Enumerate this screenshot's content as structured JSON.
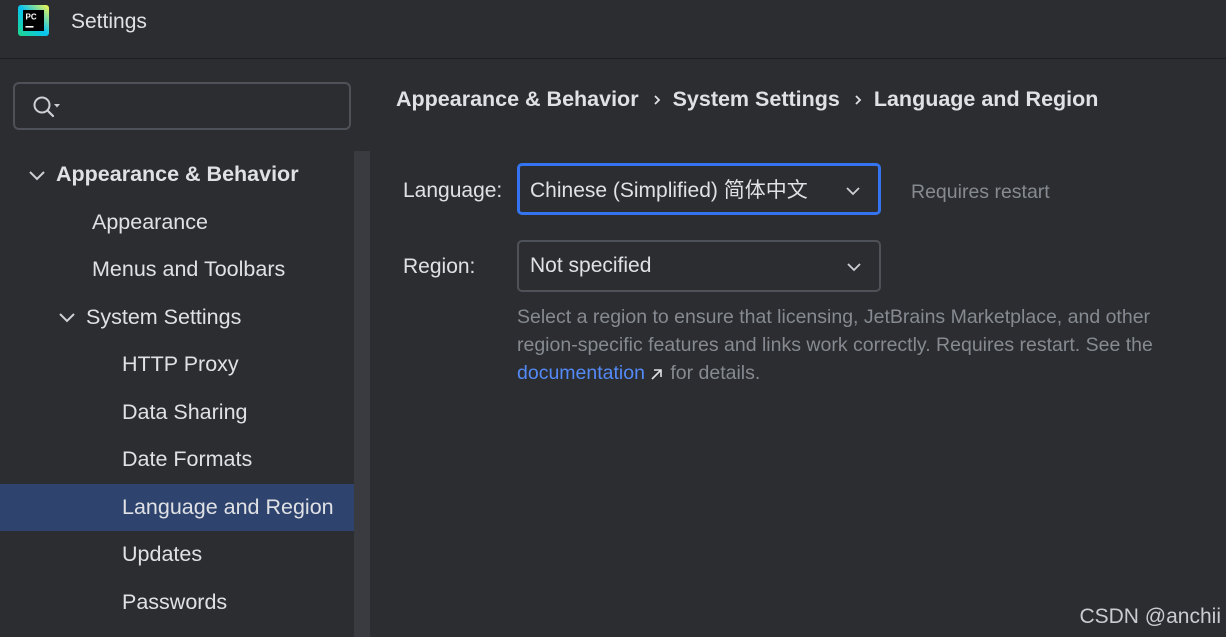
{
  "window": {
    "title": "Settings",
    "app_icon": "pycharm-logo-icon",
    "app_icon_text": "PC"
  },
  "search": {
    "placeholder": "",
    "value": ""
  },
  "sidebar": {
    "items": [
      {
        "label": "Appearance & Behavior",
        "expanded": true,
        "bold": true
      },
      {
        "label": "Appearance"
      },
      {
        "label": "Menus and Toolbars"
      },
      {
        "label": "System Settings",
        "expanded": true
      },
      {
        "label": "HTTP Proxy"
      },
      {
        "label": "Data Sharing"
      },
      {
        "label": "Date Formats"
      },
      {
        "label": "Language and Region",
        "selected": true
      },
      {
        "label": "Updates"
      },
      {
        "label": "Passwords"
      }
    ]
  },
  "breadcrumb": [
    "Appearance & Behavior",
    "System Settings",
    "Language and Region"
  ],
  "language": {
    "label": "Language:",
    "value": "Chinese (Simplified) 简体中文",
    "note": "Requires restart"
  },
  "region": {
    "label": "Region:",
    "value": "Not specified",
    "description_before": "Select a region to ensure that licensing, JetBrains Marketplace, and other region-specific features and links work correctly. Requires restart. See the ",
    "link_text": "documentation",
    "description_after": " for details."
  },
  "watermark": "CSDN @anchii",
  "colors": {
    "accent": "#3574f0",
    "link": "#548af7",
    "selection": "#2e436e",
    "background": "#2b2d30",
    "muted_text": "#868a91"
  }
}
